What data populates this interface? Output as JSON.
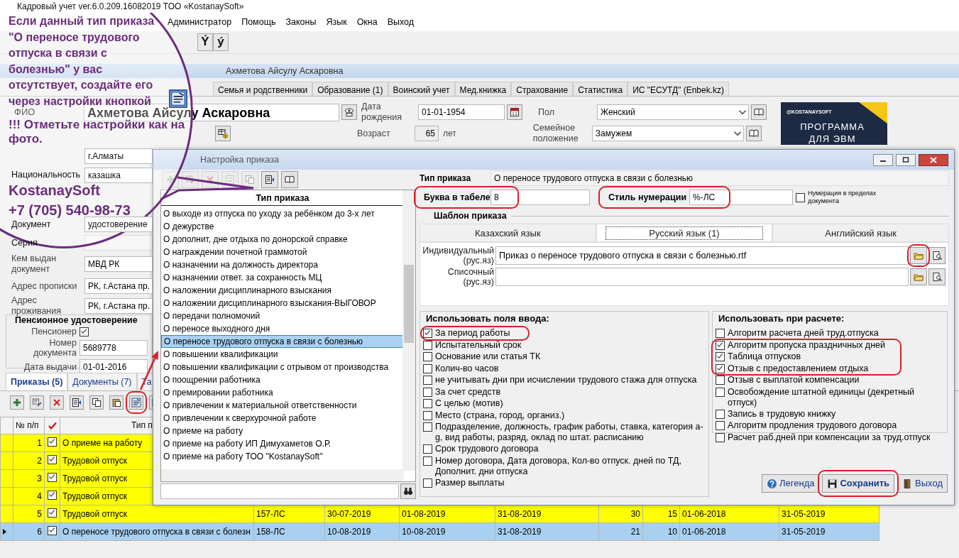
{
  "app": {
    "title": "Кадровый учет ver.6.0.209.16082019 ТОО «KostanaySoft»"
  },
  "menu": [
    "Администратор",
    "Помощь",
    "Законы",
    "Язык",
    "Окна",
    "Выход"
  ],
  "letter_keys": [
    "Ý",
    "ý"
  ],
  "employee": {
    "title": "Ахметова Айсулу Аскаровна",
    "tabs": [
      {
        "label": "Семья и родственники",
        "selected": false
      },
      {
        "label": "Образование (1)",
        "selected": false
      },
      {
        "label": "Воинский учет",
        "selected": false
      },
      {
        "label": "Мед.книжка",
        "selected": false
      },
      {
        "label": "Страхование",
        "selected": false
      },
      {
        "label": "Статистика",
        "selected": false
      },
      {
        "label": "ИС \"ЕСУТД\" (Enbek.kz)",
        "selected": false
      }
    ],
    "fio": {
      "label": "ФИО",
      "value": "Ахметова Айсулу Аскаровна"
    },
    "birth_date": {
      "label": "Дата рождения",
      "value": "01-01-1954"
    },
    "age": {
      "label": "Возраст",
      "value": "65",
      "unit": "лет"
    },
    "gender": {
      "label": "Пол",
      "value": "Женский"
    },
    "marital": {
      "label": "Семейное положение",
      "value": "Замужем"
    },
    "banner": {
      "handle": "@KOSTANAYSOFT",
      "text": "ПРОГРАММА ДЛЯ ЭВМ"
    },
    "fields": [
      {
        "value": "г.Алматы"
      },
      {
        "label": "Национальность",
        "value": "казашка"
      }
    ],
    "passport": {
      "fields": [
        {
          "label": "Документ",
          "value": "удостоверение"
        },
        {
          "label": "Серия"
        },
        {
          "label": "Кем выдан документ",
          "value": "МВД РК"
        }
      ]
    },
    "addresses": [
      {
        "label": "Адрес прописки",
        "value": "РК, г.Астана пр."
      },
      {
        "label": "Адрес проживания",
        "value": "РК, г.Астана пр."
      }
    ],
    "pension": {
      "title": "Пенсионное удостоверение",
      "pensioner": {
        "label": "Пенсионер",
        "checked": true
      },
      "number": {
        "label": "Номер документа",
        "value": "5689778"
      },
      "issue_date": {
        "label": "Дата выдачи",
        "value": "01-01-2016"
      }
    },
    "bottom_tabs": [
      {
        "label": "Приказы (5)",
        "selected": true
      },
      {
        "label": "Документы (7)",
        "selected": false
      },
      {
        "label": "Та",
        "selected": false
      }
    ],
    "orders": {
      "columns": [
        "№ п/п",
        "Тип п"
      ],
      "rows": [
        {
          "num": "1",
          "checked": true,
          "type": "О приеме на работу",
          "selected": false
        },
        {
          "num": "2",
          "checked": true,
          "type": "Трудовой отпуск",
          "selected": false
        },
        {
          "num": "3",
          "checked": true,
          "type": "Трудовой отпуск",
          "selected": false
        },
        {
          "num": "4",
          "checked": true,
          "type": "Трудовой отпуск",
          "selected": false
        },
        {
          "num": "5",
          "checked": true,
          "type": "Трудовой отпуск",
          "selected": false,
          "cells": [
            "157-ЛС",
            "30-07-2019",
            "01-08-2019",
            "31-08-2019",
            "30",
            "15",
            "01-06-2018",
            "31-05-2019"
          ]
        },
        {
          "num": "6",
          "checked": true,
          "type": "О переносе трудового отпуска в связи с болезн",
          "selected": true,
          "cells": [
            "158-ЛС",
            "10-08-2019",
            "10-08-2019",
            "31-08-2019",
            "21",
            "10",
            "01-06-2018",
            "31-05-2019"
          ]
        }
      ]
    }
  },
  "dialog": {
    "title": "Настройка приказа",
    "list_header": "Тип приказа",
    "items": [
      {
        "label": "О выходе из отпуска по уходу за ребёнком до 3-х лет",
        "selected": false
      },
      {
        "label": "О дежурстве",
        "selected": false
      },
      {
        "label": "О дополнит, дне отдыха по донорской справке",
        "selected": false
      },
      {
        "label": "О награждении почетной граммотой",
        "selected": false
      },
      {
        "label": "О назначении на должность директора",
        "selected": false
      },
      {
        "label": "О назначении ответ. за сохранность МЦ",
        "selected": false
      },
      {
        "label": "О наложении дисциплинарного взыскания",
        "selected": false
      },
      {
        "label": "О наложении дисциплинарного взыскания-ВЫГОВОР",
        "selected": false
      },
      {
        "label": "О передачи полномочий",
        "selected": false
      },
      {
        "label": "О переносе выходного дня",
        "selected": false
      },
      {
        "label": "О переносе трудового отпуска в связи с болезнью",
        "selected": true
      },
      {
        "label": "О повышении квалификации",
        "selected": false
      },
      {
        "label": "О повышении квалификации с отрывом от производства",
        "selected": false
      },
      {
        "label": "О поощрении работника",
        "selected": false
      },
      {
        "label": "О премировании работника",
        "selected": false
      },
      {
        "label": "О привлечении к материальной ответственности",
        "selected": false
      },
      {
        "label": "О привлечении к сверхурочной работе",
        "selected": false
      },
      {
        "label": "О приеме на работу",
        "selected": false
      },
      {
        "label": "О приеме на работу ИП Димухаметов О.Р.",
        "selected": false
      },
      {
        "label": "О приеме на работу ТОО \"KostanaySoft\"",
        "selected": false
      }
    ],
    "order_type": {
      "label": "Тип приказа",
      "value": "О переносе трудового отпуска в связи с болезнью"
    },
    "letter": {
      "label": "Буква в табеле",
      "value": "8"
    },
    "numbering_style": {
      "label": "Стиль нумерации",
      "value": "%-ЛС"
    },
    "numbering_in_doc": {
      "label": "Нумерация в пределах документа",
      "checked": false
    },
    "template": {
      "title": "Шаблон приказа",
      "tabs": [
        {
          "label": "Казахский язык",
          "selected": false
        },
        {
          "label": "Русский язык (1)",
          "selected": true
        },
        {
          "label": "Английский язык",
          "selected": false
        }
      ],
      "individual": {
        "label": "Индивидуальный (рус.яз)",
        "value": "Приказ о переносе трудового отпуска в связи с болезнью.rtf"
      },
      "list": {
        "label": "Списочный (рус.яз)"
      }
    },
    "input_fields": {
      "title": "Использовать поля ввода:",
      "items": [
        {
          "label": "За период работы",
          "checked": true
        },
        {
          "label": "Испытательный срок",
          "checked": false
        },
        {
          "label": "Основание или статья ТК",
          "checked": false
        },
        {
          "label": "Колич-во часов",
          "checked": false
        },
        {
          "label": "не учитывать дни при исчислении трудового стажа для отпуска",
          "checked": false
        },
        {
          "label": "За счет средств",
          "checked": false
        },
        {
          "label": "С целью (мотив)",
          "checked": false
        },
        {
          "label": "Место (страна, город, организ.)",
          "checked": false
        },
        {
          "label": "Подразделение, должность, график работы, ставка, категория a-g, вид работы, разряд, оклад по штат. расписанию",
          "checked": false
        },
        {
          "label": "Срок трудового договора",
          "checked": false
        },
        {
          "label": "Номер договора, Дата договора, Кол-во отпуск. дней по ТД, Дополнит. дни отпуска",
          "checked": false
        },
        {
          "label": "Размер выплаты",
          "checked": false
        }
      ]
    },
    "calc": {
      "title": "Использовать при расчете:",
      "items": [
        {
          "label": "Алгоритм расчета дней труд.отпуска",
          "checked": false
        },
        {
          "label": "Алгоритм пропуска праздничных дней",
          "checked": true
        },
        {
          "label": "Таблица отпусков",
          "checked": true
        },
        {
          "label": "Отзыв с предоставлением отдыха",
          "checked": true
        },
        {
          "label": "Отзыв с выплатой компенсации",
          "checked": false
        },
        {
          "label": "Освобождение штатной единицы (декретный отпуск)",
          "checked": false
        },
        {
          "label": "Запись в трудовую книжку",
          "checked": false
        },
        {
          "label": "Алгоритм продления трудового договора",
          "checked": false
        },
        {
          "label": "Расчет раб.дней при компенсации за труд.отпуск",
          "checked": false
        }
      ]
    },
    "buttons": [
      {
        "label": "Легенда",
        "kind": "help"
      },
      {
        "label": "Сохранить",
        "kind": "save"
      },
      {
        "label": "Выход",
        "kind": "exit"
      }
    ]
  },
  "callout": {
    "message": "Если данный тип приказа \"О переносе трудового отпуска в связи с болезнью\" у вас отсутствует, создайте его через настройки кнопкой",
    "note": "!!! Отметьте настройки как на фото.",
    "company": "KostanaySoft",
    "phone": "+7 (705) 540-98-73"
  }
}
